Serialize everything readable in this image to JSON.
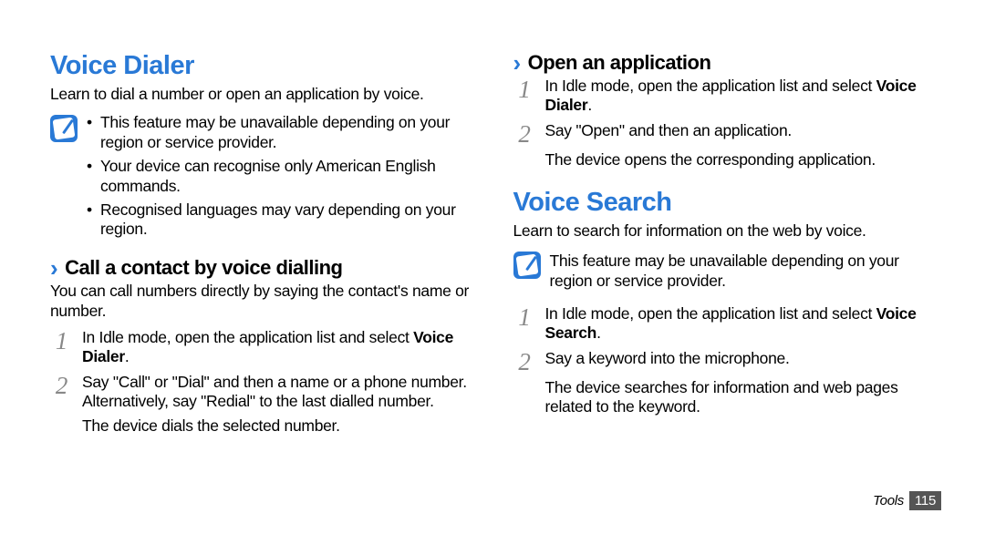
{
  "left": {
    "h1": "Voice Dialer",
    "lead": "Learn to dial a number or open an application by voice.",
    "note_b1": "This feature may be unavailable depending on your region or service provider.",
    "note_b2": "Your device can recognise only American English commands.",
    "note_b3": "Recognised languages may vary depending on your region.",
    "h2": "Call a contact by voice dialling",
    "p1": "You can call numbers directly by saying the contact's name or number.",
    "s1_pre": "In Idle mode, open the application list and select ",
    "s1_bold": "Voice Dialer",
    "s1_post": ".",
    "s2a": "Say \"Call\" or \"Dial\" and then a name or a phone number. Alternatively, say \"Redial\" to the last dialled number.",
    "s2b": "The device dials the selected number."
  },
  "right": {
    "h2a": "Open an application",
    "a_s1_pre": "In Idle mode, open the application list and select ",
    "a_s1_bold": "Voice Dialer",
    "a_s1_post": ".",
    "a_s2a": "Say \"Open\" and then an application.",
    "a_s2b": "The device opens the corresponding application.",
    "h1b": "Voice Search",
    "leadb": "Learn to search for information on the web by voice.",
    "noteb": "This feature may be unavailable depending on your region or service provider.",
    "b_s1_pre": "In Idle mode, open the application list and select ",
    "b_s1_bold": "Voice Search",
    "b_s1_post": ".",
    "b_s2a": "Say a keyword into the microphone.",
    "b_s2b": "The device searches for information and web pages related to the keyword."
  },
  "nums": {
    "n1": "1",
    "n2": "2"
  },
  "footer": {
    "section": "Tools",
    "page": "115"
  }
}
